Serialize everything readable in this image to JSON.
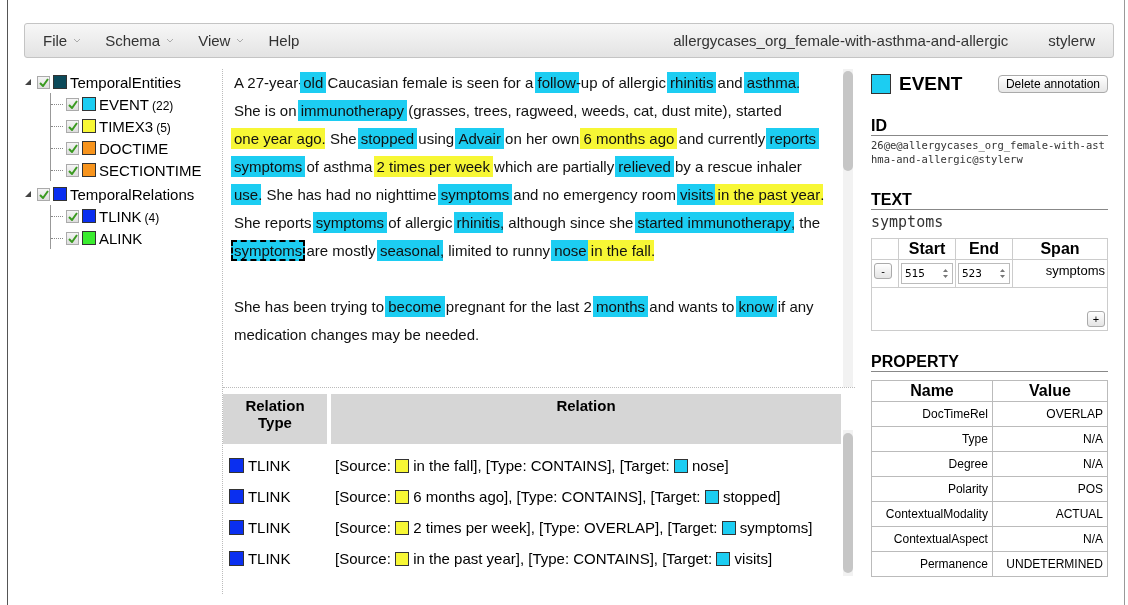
{
  "menu": [
    {
      "label": "File",
      "dropdown": true
    },
    {
      "label": "Schema",
      "dropdown": true
    },
    {
      "label": "View",
      "dropdown": true
    },
    {
      "label": "Help",
      "dropdown": false
    }
  ],
  "document_name": "allergycases_org_female-with-asthma-and-allergic",
  "user": "stylerw",
  "tree": [
    {
      "label": "TemporalEntities",
      "color": "#0c4a5a",
      "checked": true,
      "expanded": true,
      "children": [
        {
          "label": "EVENT",
          "count": "(22)",
          "color": "#1ccdf2",
          "checked": true
        },
        {
          "label": "TIMEX3",
          "count": "(5)",
          "color": "#f7f735",
          "checked": true
        },
        {
          "label": "DOCTIME",
          "color": "#f7941d",
          "checked": true
        },
        {
          "label": "SECTIONTIME",
          "color": "#f7941d",
          "checked": true
        }
      ]
    },
    {
      "label": "TemporalRelations",
      "color": "#0a2ff0",
      "checked": true,
      "expanded": true,
      "children": [
        {
          "label": "TLINK",
          "count": "(4)",
          "color": "#0a2ff0",
          "checked": true
        },
        {
          "label": "ALINK",
          "color": "#3aec2f",
          "checked": true
        }
      ]
    }
  ],
  "document": [
    [
      {
        "kind": "plain",
        "text": "A 27-year-"
      },
      {
        "kind": "event",
        "text": "old",
        "selected": false
      },
      {
        "kind": "plain",
        "text": " Caucasian female is seen for a "
      },
      {
        "kind": "event",
        "text": "follow",
        "selected": false
      },
      {
        "kind": "plain",
        "text": "-up of allergic "
      },
      {
        "kind": "event",
        "text": "rhinitis",
        "selected": false
      },
      {
        "kind": "plain",
        "text": " and "
      },
      {
        "kind": "event",
        "text": "asthma",
        "selected": false
      },
      {
        "kind": "plain",
        "text": ". She is on "
      },
      {
        "kind": "event",
        "text": "immunotherapy",
        "selected": false
      },
      {
        "kind": "plain",
        "text": " (grasses, trees, ragweed, weeds, cat, dust mite), started "
      },
      {
        "kind": "timex",
        "text": "one year ago",
        "selected": false
      },
      {
        "kind": "plain",
        "text": ". She "
      },
      {
        "kind": "event",
        "text": "stopped",
        "selected": false
      },
      {
        "kind": "plain",
        "text": " using "
      },
      {
        "kind": "event",
        "text": "Advair",
        "selected": false
      },
      {
        "kind": "plain",
        "text": " on her own "
      },
      {
        "kind": "timex",
        "text": "6 months ago",
        "selected": false
      },
      {
        "kind": "plain",
        "text": " and currently "
      },
      {
        "kind": "event",
        "text": "reports",
        "selected": false,
        "space_after": true
      },
      {
        "kind": "event",
        "text": "symptoms",
        "selected": false
      },
      {
        "kind": "plain",
        "text": " of asthma "
      },
      {
        "kind": "timex",
        "text": "2 times per week",
        "selected": false
      },
      {
        "kind": "plain",
        "text": " which are partially "
      },
      {
        "kind": "event",
        "text": "relieved",
        "selected": false
      },
      {
        "kind": "plain",
        "text": " by a rescue inhaler "
      },
      {
        "kind": "event",
        "text": "use",
        "selected": false
      },
      {
        "kind": "plain",
        "text": ". She has had no nighttime "
      },
      {
        "kind": "event",
        "text": "symptoms",
        "selected": false
      },
      {
        "kind": "plain",
        "text": " and no emergency room "
      },
      {
        "kind": "event",
        "text": "visits",
        "selected": false,
        "space_after": true
      },
      {
        "kind": "timex",
        "text": "in the past year",
        "selected": false
      },
      {
        "kind": "plain",
        "text": ". She reports "
      },
      {
        "kind": "event",
        "text": "symptoms",
        "selected": false
      },
      {
        "kind": "plain",
        "text": " of allergic "
      },
      {
        "kind": "event",
        "text": "rhinitis",
        "selected": false
      },
      {
        "kind": "plain",
        "text": ", although since she "
      },
      {
        "kind": "event",
        "text": "started",
        "selected": false,
        "space_after": true
      },
      {
        "kind": "event",
        "text": "immunotherapy",
        "selected": false
      },
      {
        "kind": "plain",
        "text": ", the "
      },
      {
        "kind": "event",
        "text": "symptoms",
        "selected": true
      },
      {
        "kind": "plain",
        "text": " are mostly "
      },
      {
        "kind": "event",
        "text": "seasonal",
        "selected": false
      },
      {
        "kind": "plain",
        "text": ", limited to runny "
      },
      {
        "kind": "event",
        "text": "nose",
        "selected": false,
        "space_after": true
      },
      {
        "kind": "timex",
        "text": "in the fall",
        "selected": false
      },
      {
        "kind": "plain",
        "text": "."
      }
    ],
    [
      {
        "kind": "plain",
        "text": "She has been trying to "
      },
      {
        "kind": "event",
        "text": "become",
        "selected": false
      },
      {
        "kind": "plain",
        "text": " pregnant for the last 2 "
      },
      {
        "kind": "event",
        "text": "months",
        "selected": false
      },
      {
        "kind": "plain",
        "text": " and wants to "
      },
      {
        "kind": "event",
        "text": "know",
        "selected": false
      },
      {
        "kind": "plain",
        "text": " if any medication changes may be needed."
      }
    ]
  ],
  "relations": {
    "columns": [
      "Relation Type",
      "Relation"
    ],
    "rows": [
      {
        "type": "TLINK",
        "color": "#0a2ff0",
        "parts": [
          {
            "text": "[Source: "
          },
          {
            "color": "#f7f735",
            "text": "in the fall], [Type: CONTAINS], [Target: "
          },
          {
            "color": "#1ccdf2",
            "text": "nose]"
          }
        ]
      },
      {
        "type": "TLINK",
        "color": "#0a2ff0",
        "parts": [
          {
            "text": "[Source: "
          },
          {
            "color": "#f7f735",
            "text": "6 months ago], [Type: CONTAINS], [Target: "
          },
          {
            "color": "#1ccdf2",
            "text": "stopped]"
          }
        ]
      },
      {
        "type": "TLINK",
        "color": "#0a2ff0",
        "parts": [
          {
            "text": "[Source: "
          },
          {
            "color": "#f7f735",
            "text": "2 times per week], [Type: OVERLAP], [Target: "
          },
          {
            "color": "#1ccdf2",
            "text": "symptoms]"
          }
        ]
      },
      {
        "type": "TLINK",
        "color": "#0a2ff0",
        "parts": [
          {
            "text": "[Source: "
          },
          {
            "color": "#f7f735",
            "text": "in the past year], [Type: CONTAINS], [Target: "
          },
          {
            "color": "#1ccdf2",
            "text": "visits]"
          }
        ]
      }
    ]
  },
  "annotation": {
    "type": "EVENT",
    "color": "#1ccdf2",
    "delete_button": "Delete annotation",
    "id_heading": "ID",
    "id": "26@e@allergycases_org_female-with-asthma-and-allergic@stylerw",
    "text_heading": "TEXT",
    "text": "symptoms",
    "span_columns": [
      "Start",
      "End",
      "Span"
    ],
    "spans": [
      {
        "start": "515",
        "end": "523",
        "span": "symptoms"
      }
    ],
    "remove_button": "-",
    "add_button": "+",
    "property_heading": "PROPERTY",
    "property_columns": [
      "Name",
      "Value"
    ],
    "properties": [
      {
        "name": "DocTimeRel",
        "value": "OVERLAP"
      },
      {
        "name": "Type",
        "value": "N/A"
      },
      {
        "name": "Degree",
        "value": "N/A"
      },
      {
        "name": "Polarity",
        "value": "POS"
      },
      {
        "name": "ContextualModality",
        "value": "ACTUAL"
      },
      {
        "name": "ContextualAspect",
        "value": "N/A"
      },
      {
        "name": "Permanence",
        "value": "UNDETERMINED"
      }
    ]
  }
}
